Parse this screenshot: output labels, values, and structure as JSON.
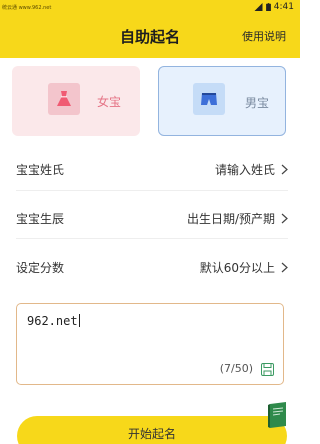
{
  "status_bar": {
    "left_text": "统云通 www.962.net",
    "time": "4:41"
  },
  "header": {
    "title": "自助起名",
    "help_label": "使用说明"
  },
  "gender": {
    "female_label": "女宝",
    "male_label": "男宝",
    "selected": "male"
  },
  "form": {
    "surname": {
      "label": "宝宝姓氏",
      "placeholder": "请输入姓氏"
    },
    "birth": {
      "label": "宝宝生辰",
      "placeholder": "出生日期/预产期"
    },
    "score": {
      "label": "设定分数",
      "value": "默认60分以上"
    }
  },
  "textarea": {
    "value": "962.net",
    "count": "(7/50)"
  },
  "start_button_label": "开始起名",
  "colors": {
    "accent": "#f7d81a",
    "female_bg": "#fbe8ea",
    "male_bg": "#e7f1fd",
    "female_text": "#e57486"
  }
}
